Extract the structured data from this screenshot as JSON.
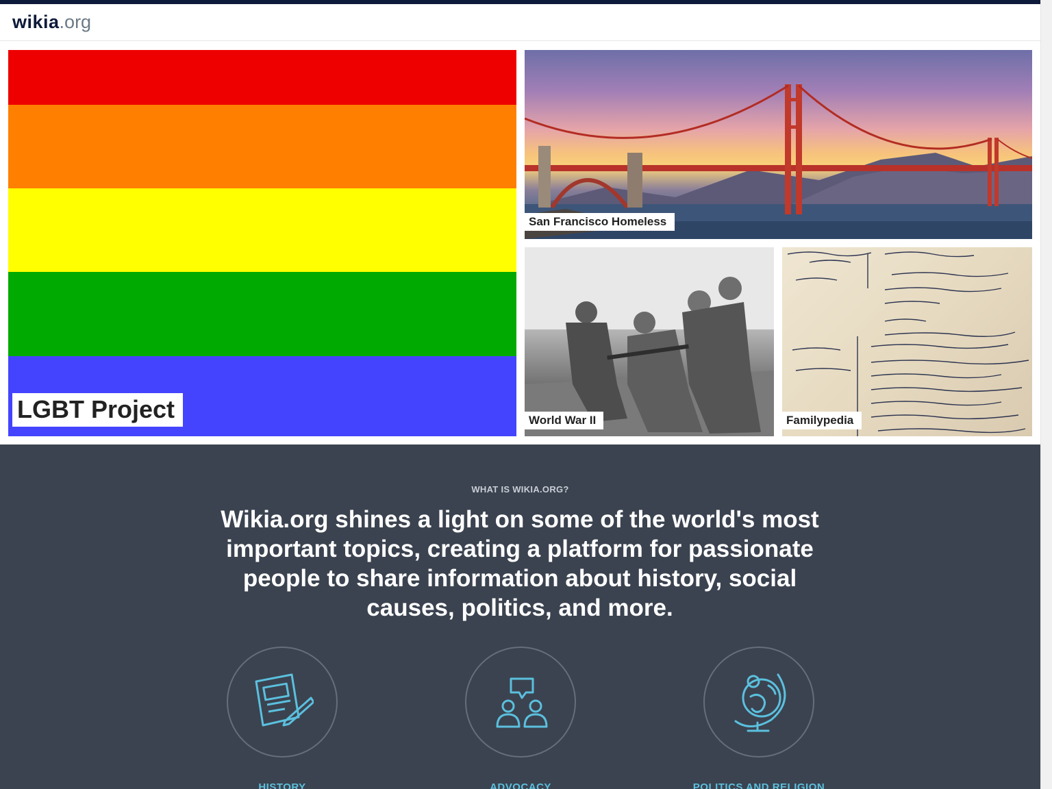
{
  "header": {
    "logo_main": "wikia",
    "logo_suffix": ".org"
  },
  "tiles": {
    "lgbt": {
      "label": "LGBT Project",
      "colors": [
        "#ee0000",
        "#ff7f00",
        "#ffff00",
        "#00aa00",
        "#4444ff"
      ]
    },
    "sf": {
      "label": "San Francisco Homeless"
    },
    "ww2": {
      "label": "World War II"
    },
    "family": {
      "label": "Familypedia"
    }
  },
  "about": {
    "eyebrow": "WHAT IS WIKIA.ORG?",
    "headline": "Wikia.org shines a light on some of the world's most important topics, creating a platform for passionate people to share information about history, social causes, politics, and more.",
    "features": [
      {
        "label": "HISTORY",
        "icon": "document-pencil-icon"
      },
      {
        "label": "ADVOCACY",
        "icon": "people-chat-icon"
      },
      {
        "label": "POLITICS AND RELIGION",
        "icon": "globe-icon"
      }
    ],
    "accent": "#5bc0de"
  }
}
